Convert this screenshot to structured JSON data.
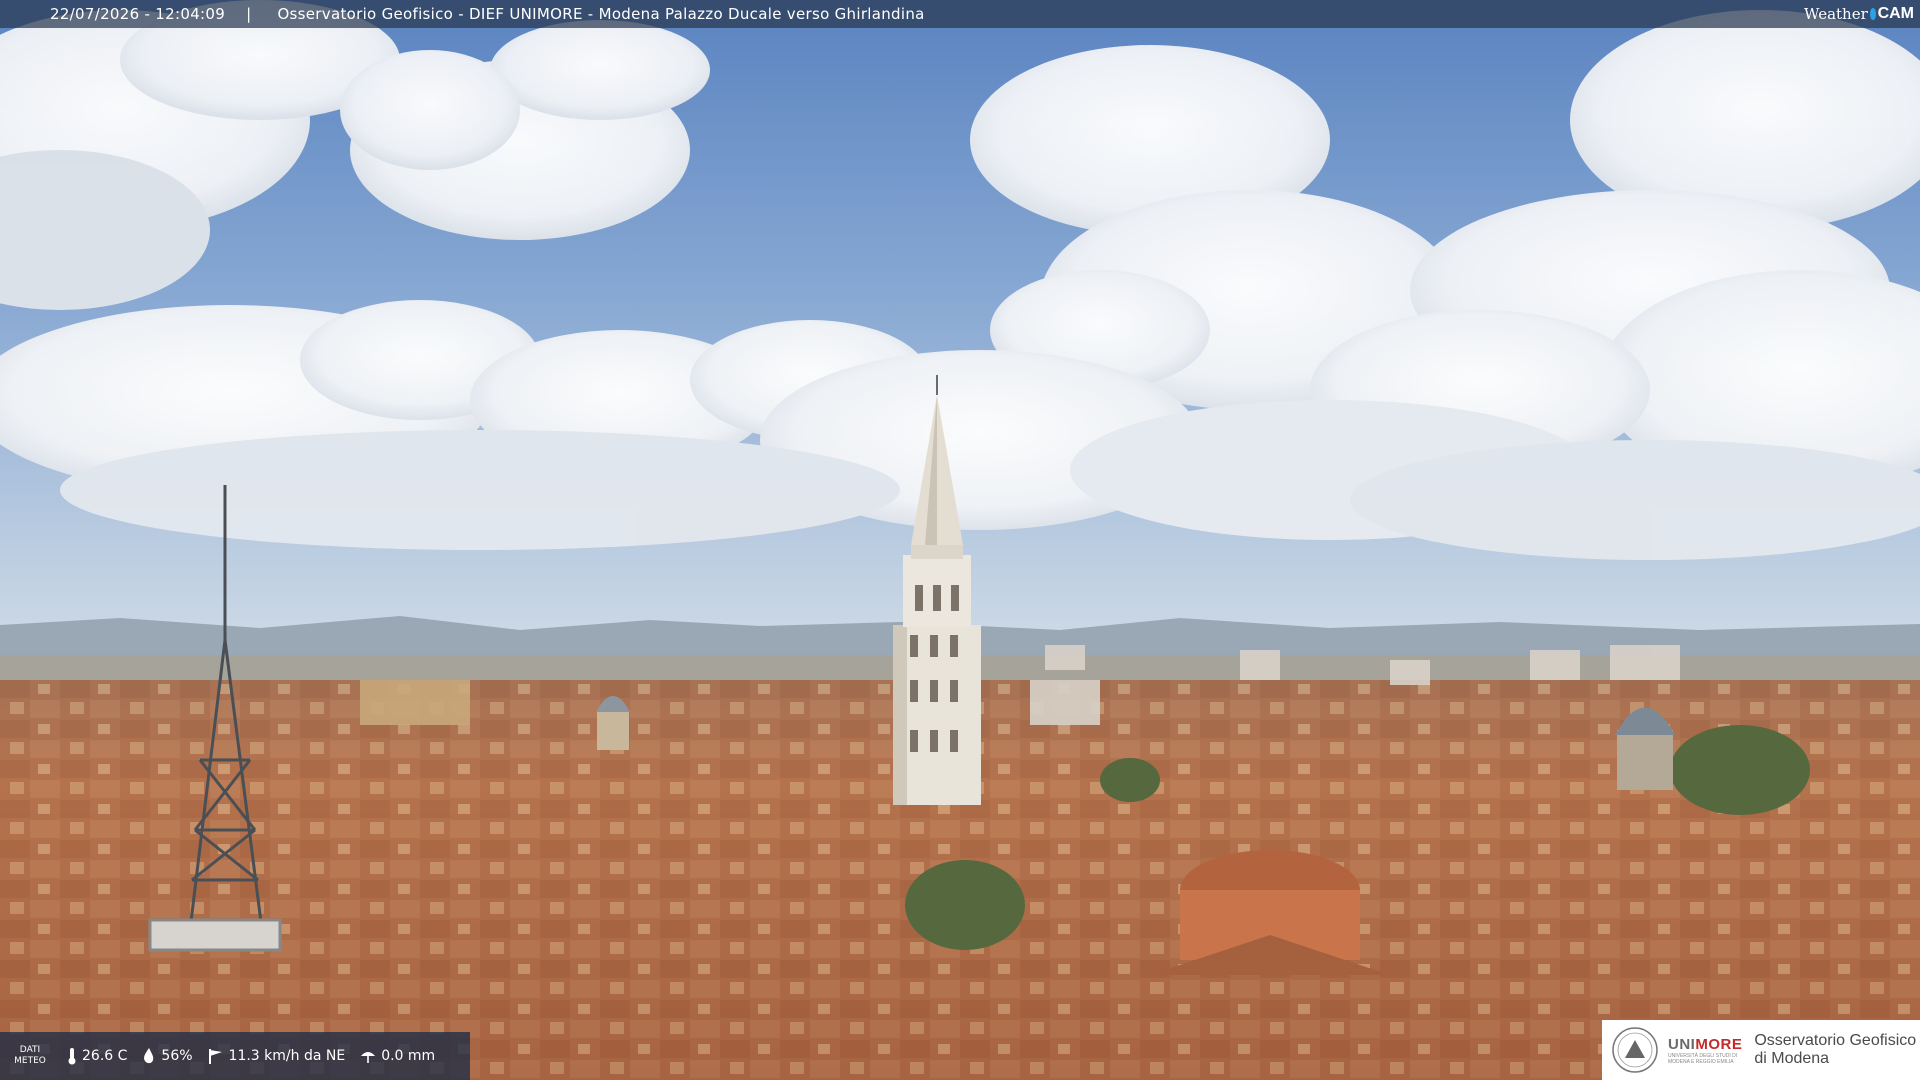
{
  "header": {
    "timestamp": "22/07/2026 - 12:04:09",
    "separator": "|",
    "location": "Osservatorio Geofisico - DIEF UNIMORE - Modena Palazzo Ducale verso Ghirlandina"
  },
  "weathercam_logo": {
    "word": "Weather",
    "cam": "CAM"
  },
  "meteo": {
    "label_line1": "DATI",
    "label_line2": "METEO",
    "temperature": "26.6 C",
    "humidity": "56%",
    "wind": "11.3 km/h da NE",
    "rain": "0.0 mm",
    "icons": [
      "thermometer-icon",
      "humidity-drop-icon",
      "wind-icon",
      "rain-icon"
    ]
  },
  "unimore_logo": {
    "name_uni": "UNI",
    "name_more": "MORE",
    "subtitle_line1": "UNIVERSITÀ DEGLI STUDI DI",
    "subtitle_line2": "MODENA E REGGIO EMILIA",
    "observatory_line1": "Osservatorio Geofisico",
    "observatory_line2": "di Modena"
  },
  "colors": {
    "sky_top": "#5d86c2",
    "sky_horizon": "#c9d6e3",
    "roof": "#b06a45",
    "tower": "#e8e2d6",
    "accent_red": "#c42a2a"
  }
}
